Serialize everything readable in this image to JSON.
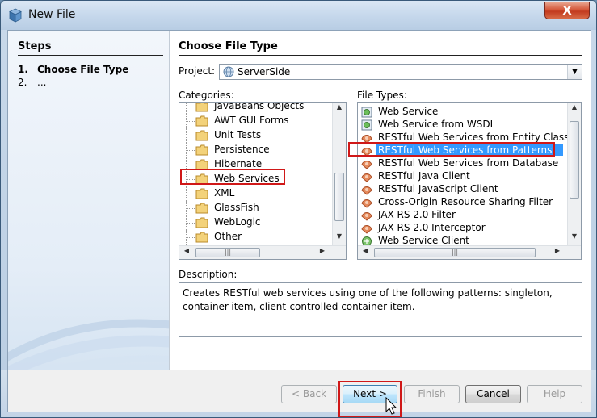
{
  "window": {
    "title": "New File",
    "close_label": "X"
  },
  "steps": {
    "title": "Steps",
    "items": [
      {
        "num": "1.",
        "label": "Choose File Type"
      },
      {
        "num": "2.",
        "label": "..."
      }
    ]
  },
  "main": {
    "title": "Choose File Type"
  },
  "project": {
    "label": "Project:",
    "value": "ServerSide"
  },
  "categories": {
    "label": "Categories:",
    "items": [
      {
        "label": "JavaBeans Objects"
      },
      {
        "label": "AWT GUI Forms"
      },
      {
        "label": "Unit Tests"
      },
      {
        "label": "Persistence"
      },
      {
        "label": "Hibernate"
      },
      {
        "label": "Web Services",
        "selected": true
      },
      {
        "label": "XML"
      },
      {
        "label": "GlassFish"
      },
      {
        "label": "WebLogic"
      },
      {
        "label": "Other"
      }
    ]
  },
  "file_types": {
    "label": "File Types:",
    "items": [
      {
        "label": "Web Service",
        "icon": "web-service-icon"
      },
      {
        "label": "Web Service from WSDL",
        "icon": "web-service-icon"
      },
      {
        "label": "RESTful Web Services from Entity Classes",
        "icon": "restful-icon"
      },
      {
        "label": "RESTful Web Services from Patterns",
        "icon": "restful-icon",
        "selected": true
      },
      {
        "label": "RESTful Web Services from Database",
        "icon": "restful-icon"
      },
      {
        "label": "RESTful Java Client",
        "icon": "restful-icon"
      },
      {
        "label": "RESTful JavaScript Client",
        "icon": "restful-icon"
      },
      {
        "label": "Cross-Origin Resource Sharing Filter",
        "icon": "restful-icon"
      },
      {
        "label": "JAX-RS 2.0 Filter",
        "icon": "restful-icon"
      },
      {
        "label": "JAX-RS 2.0 Interceptor",
        "icon": "restful-icon"
      },
      {
        "label": "Web Service Client",
        "icon": "web-service-client-icon"
      }
    ]
  },
  "description": {
    "label": "Description:",
    "text": "Creates RESTful web services using one of the following patterns: singleton, container-item, client-controlled container-item."
  },
  "buttons": {
    "back": "< Back",
    "next": "Next >",
    "finish": "Finish",
    "cancel": "Cancel",
    "help": "Help"
  },
  "colors": {
    "selection": "#3399ff",
    "highlight": "#d01818"
  }
}
